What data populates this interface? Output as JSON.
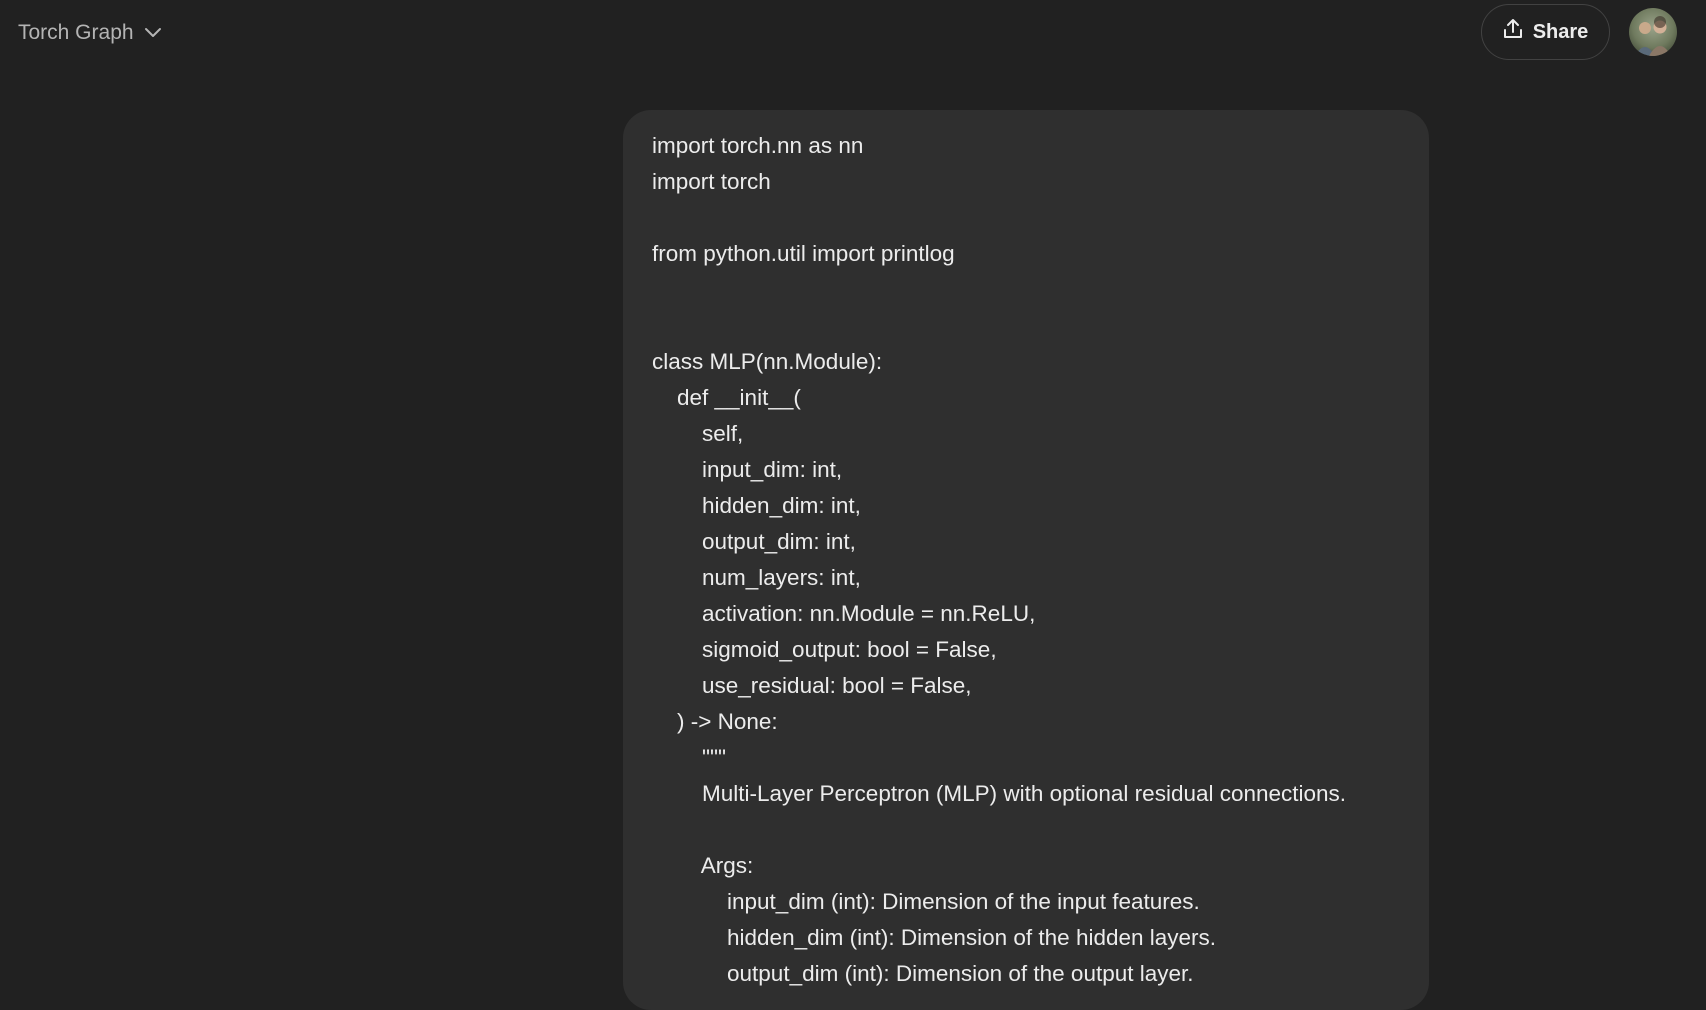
{
  "header": {
    "title": "Torch Graph",
    "share_label": "Share"
  },
  "message": {
    "lines": [
      "import torch.nn as nn",
      "import torch",
      "",
      "from python.util import printlog",
      "",
      "",
      "class MLP(nn.Module):",
      "    def __init__(",
      "        self,",
      "        input_dim: int,",
      "        hidden_dim: int,",
      "        output_dim: int,",
      "        num_layers: int,",
      "        activation: nn.Module = nn.ReLU,",
      "        sigmoid_output: bool = False,",
      "        use_residual: bool = False,",
      "    ) -> None:",
      "        \"\"\"",
      "        Multi-Layer Perceptron (MLP) with optional residual connections.",
      "",
      "        Args:",
      "            input_dim (int): Dimension of the input features.",
      "            hidden_dim (int): Dimension of the hidden layers.",
      "            output_dim (int): Dimension of the output layer."
    ]
  },
  "icons": {
    "chevron": "chevron-down-icon",
    "share": "share-upload-icon",
    "avatar": "user-avatar"
  },
  "colors": {
    "background": "#212121",
    "bubble": "#2f2f2f",
    "text": "#ececec",
    "muted": "#b4b4b4",
    "border": "#424242"
  }
}
